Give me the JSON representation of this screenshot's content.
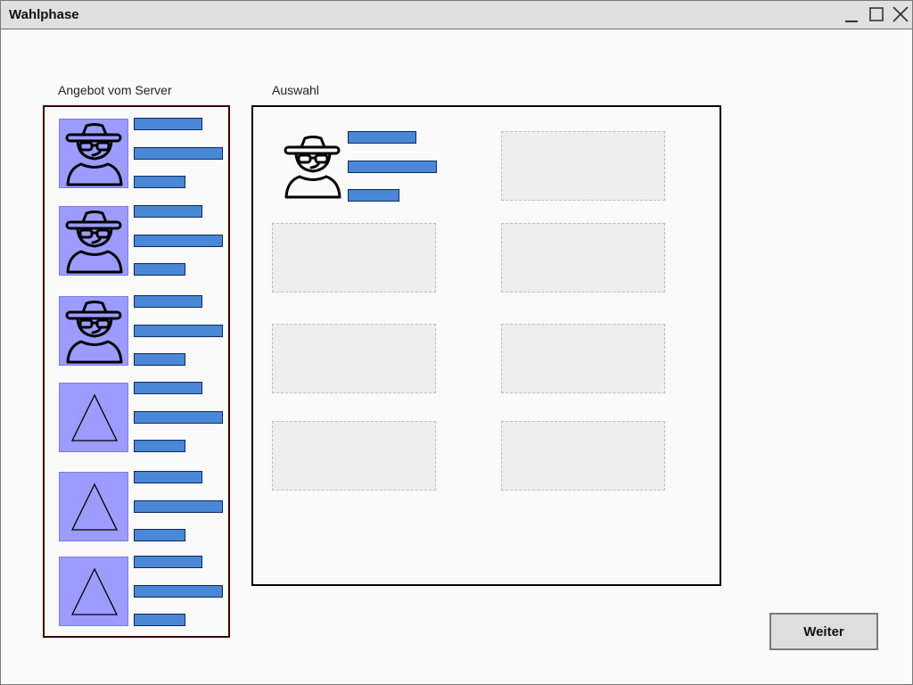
{
  "window": {
    "title": "Wahlphase"
  },
  "offer": {
    "label": "Angebot vom Server",
    "items": [
      {
        "icon": "spy-avatar-icon"
      },
      {
        "icon": "spy-avatar-icon"
      },
      {
        "icon": "spy-avatar-icon"
      },
      {
        "icon": "triangle-icon"
      },
      {
        "icon": "triangle-icon"
      },
      {
        "icon": "triangle-icon"
      }
    ]
  },
  "selection": {
    "label": "Auswahl",
    "filled": [
      {
        "icon": "spy-avatar-icon"
      }
    ],
    "empty_slots": 7
  },
  "actions": {
    "next_label": "Weiter"
  },
  "colors": {
    "thumb_bg": "#9c9cff",
    "bar_fill": "#4a87d6",
    "bar_border": "#0d2a60",
    "offer_border": "#3a0000"
  }
}
